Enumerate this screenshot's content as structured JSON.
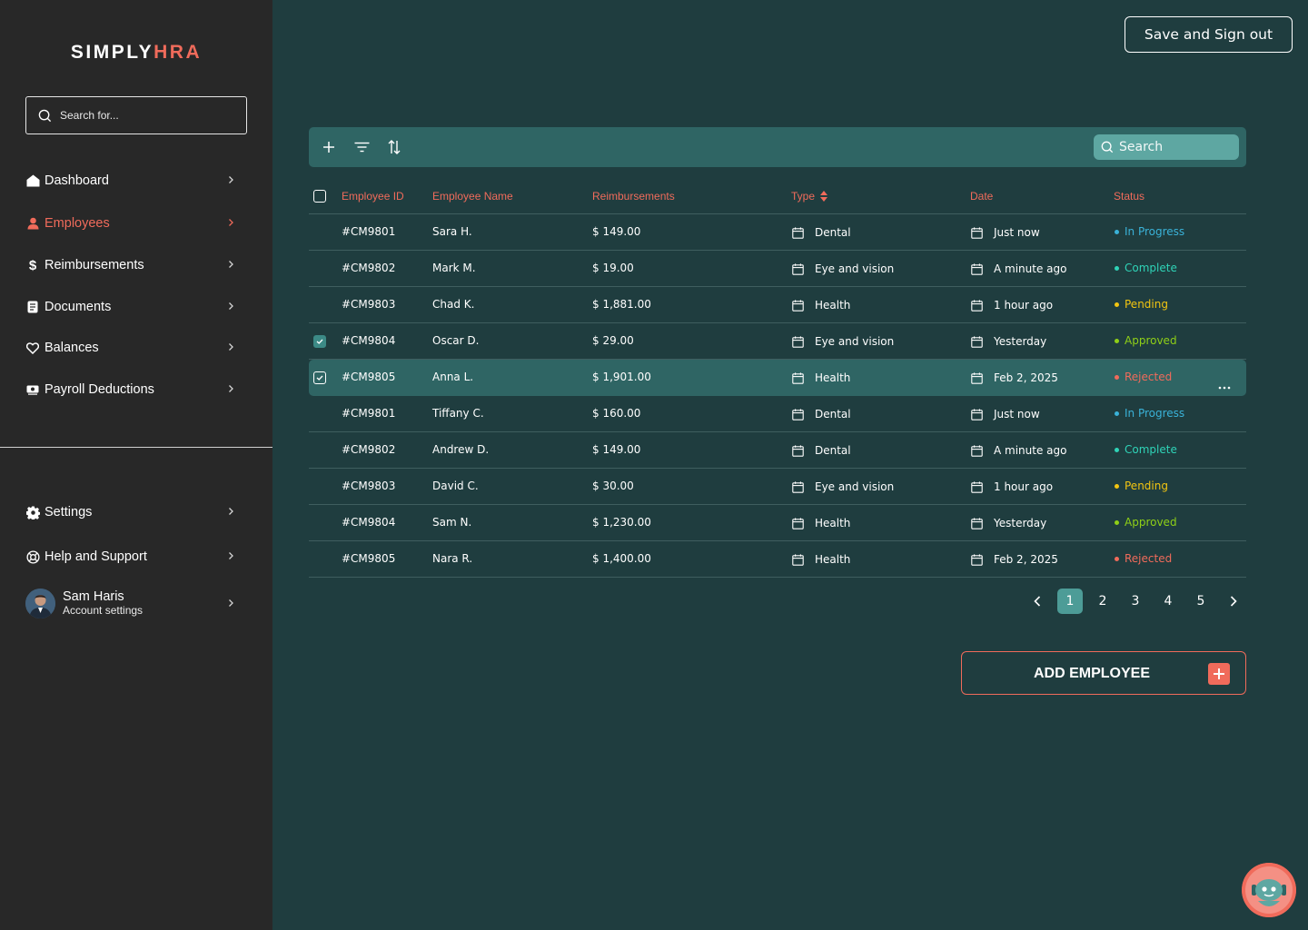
{
  "brand": {
    "logo_main": "SIMPLY",
    "logo_accent": "HRA"
  },
  "sidebar": {
    "search_placeholder": "Search for...",
    "items": [
      {
        "label": "Dashboard",
        "icon": "home-icon",
        "active": false
      },
      {
        "label": "Employees",
        "icon": "person-icon",
        "active": true
      },
      {
        "label": "Reimbursements",
        "icon": "dollar-icon",
        "active": false
      },
      {
        "label": "Documents",
        "icon": "document-icon",
        "active": false
      },
      {
        "label": "Balances",
        "icon": "heart-icon",
        "active": false
      },
      {
        "label": "Payroll Deductions",
        "icon": "payroll-icon",
        "active": false
      }
    ],
    "bottom_items": [
      {
        "label": "Settings",
        "icon": "gear-icon"
      },
      {
        "label": "Help and Support",
        "icon": "lifebuoy-icon"
      }
    ],
    "user": {
      "name": "Sam Haris",
      "subtitle": "Account settings"
    }
  },
  "header": {
    "signout_label": "Save and Sign out"
  },
  "toolbar": {
    "search_placeholder": "Search"
  },
  "table": {
    "columns": [
      "Employee ID",
      "Employee Name",
      "Reimbursements",
      "Type",
      "Date",
      "Status"
    ],
    "rows": [
      {
        "id": "#CM9801",
        "name": "Sara H.",
        "amount": "$ 149.00",
        "type": "Dental",
        "date": "Just now",
        "status": "In Progress",
        "checked": false,
        "selected": false
      },
      {
        "id": "#CM9802",
        "name": "Mark M.",
        "amount": "$ 19.00",
        "type": "Eye and vision",
        "date": "A minute ago",
        "status": "Complete",
        "checked": false,
        "selected": false
      },
      {
        "id": "#CM9803",
        "name": "Chad K.",
        "amount": "$ 1,881.00",
        "type": "Health",
        "date": "1 hour ago",
        "status": "Pending",
        "checked": false,
        "selected": false
      },
      {
        "id": "#CM9804",
        "name": "Oscar D.",
        "amount": "$ 29.00",
        "type": "Eye and vision",
        "date": "Yesterday",
        "status": "Approved",
        "checked": true,
        "selected": false
      },
      {
        "id": "#CM9805",
        "name": "Anna L.",
        "amount": "$ 1,901.00",
        "type": "Health",
        "date": "Feb 2, 2025",
        "status": "Rejected",
        "checked": true,
        "selected": true
      },
      {
        "id": "#CM9801",
        "name": "Tiffany C.",
        "amount": "$ 160.00",
        "type": "Dental",
        "date": "Just now",
        "status": "In Progress",
        "checked": false,
        "selected": false
      },
      {
        "id": "#CM9802",
        "name": "Andrew D.",
        "amount": "$ 149.00",
        "type": "Dental",
        "date": "A minute ago",
        "status": "Complete",
        "checked": false,
        "selected": false
      },
      {
        "id": "#CM9803",
        "name": "David C.",
        "amount": "$ 30.00",
        "type": "Eye and vision",
        "date": "1 hour ago",
        "status": "Pending",
        "checked": false,
        "selected": false
      },
      {
        "id": "#CM9804",
        "name": "Sam N.",
        "amount": "$ 1,230.00",
        "type": "Health",
        "date": "Yesterday",
        "status": "Approved",
        "checked": false,
        "selected": false
      },
      {
        "id": "#CM9805",
        "name": "Nara R.",
        "amount": "$ 1,400.00",
        "type": "Health",
        "date": "Feb 2, 2025",
        "status": "Rejected",
        "checked": false,
        "selected": false
      }
    ]
  },
  "status_colors": {
    "In Progress": "#3ab2d8",
    "Complete": "#2fd3b7",
    "Pending": "#f2c511",
    "Approved": "#8fcf17",
    "Rejected": "#f06b5b"
  },
  "pagination": {
    "pages": [
      "1",
      "2",
      "3",
      "4",
      "5"
    ],
    "current": "1"
  },
  "add_button": {
    "label": "ADD EMPLOYEE"
  },
  "colors": {
    "accent": "#f06b5b",
    "background": "#1f3d3f",
    "sidebar": "#282828",
    "toolbar": "#2f6564"
  }
}
